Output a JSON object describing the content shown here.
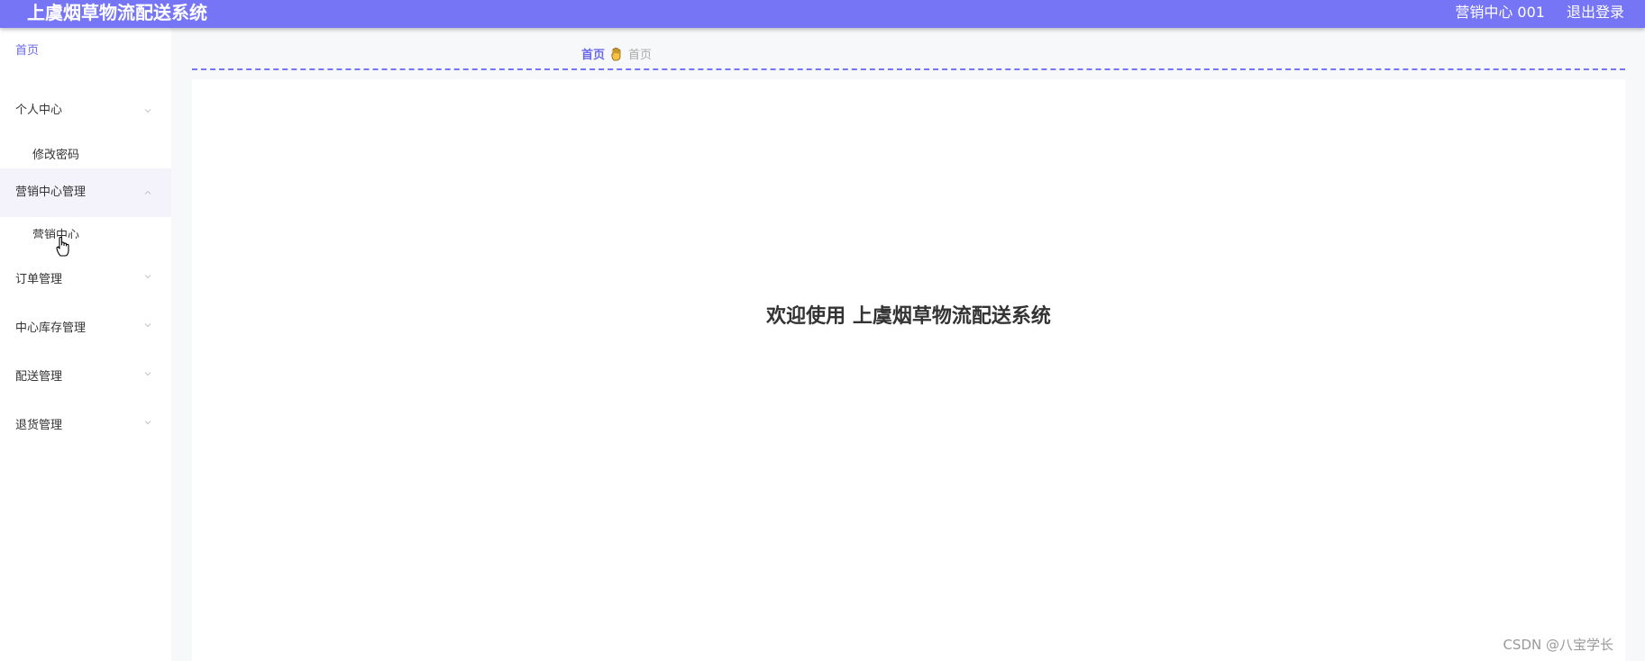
{
  "header": {
    "title": "上虞烟草物流配送系统",
    "user": "营销中心 001",
    "logout": "退出登录",
    "color": "#7675f5"
  },
  "sidebar": {
    "items": [
      {
        "label": "首页"
      },
      {
        "label": "个人中心"
      },
      {
        "label": "修改密码"
      },
      {
        "label": "营销中心管理"
      },
      {
        "label": "营销中心"
      },
      {
        "label": "订单管理"
      },
      {
        "label": "中心库存管理"
      },
      {
        "label": "配送管理"
      },
      {
        "label": "退货管理"
      }
    ]
  },
  "breadcrumb": {
    "home": "首页",
    "current": "首页"
  },
  "main": {
    "welcome": "欢迎使用 上虞烟草物流配送系统"
  },
  "watermark": "CSDN @八宝学长"
}
